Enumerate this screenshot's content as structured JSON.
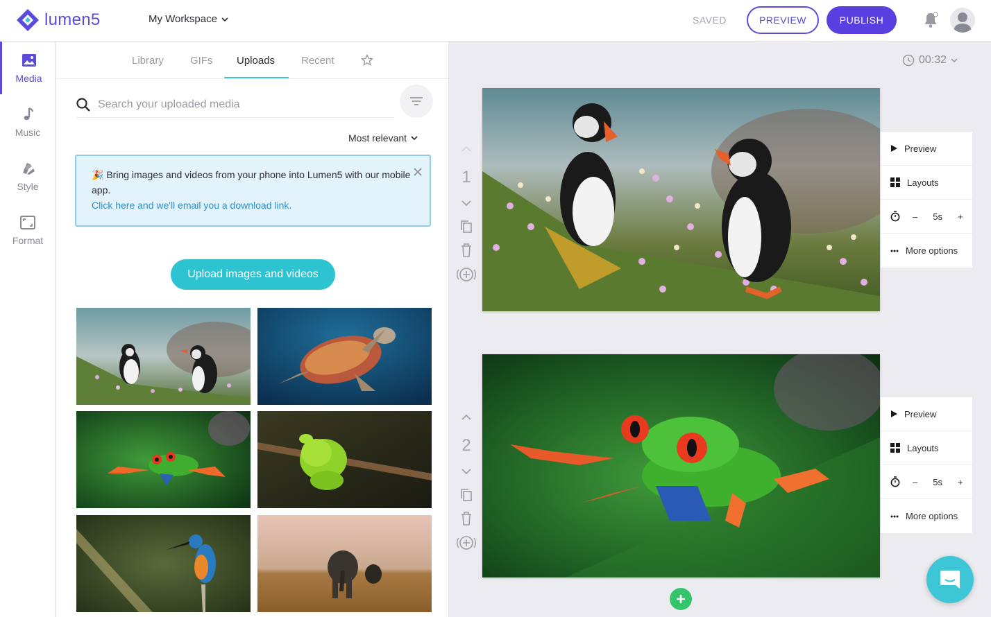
{
  "app": {
    "name": "lumen5",
    "brand_color": "#5a4bdb",
    "accent_color": "#2ec3d1"
  },
  "header": {
    "workspace_label": "My Workspace",
    "status_text": "SAVED",
    "preview_label": "PREVIEW",
    "publish_label": "PUBLISH"
  },
  "sidebar": {
    "items": [
      {
        "label": "Media",
        "icon": "image-icon",
        "active": true
      },
      {
        "label": "Music",
        "icon": "music-note-icon",
        "active": false
      },
      {
        "label": "Style",
        "icon": "palette-icon",
        "active": false
      },
      {
        "label": "Format",
        "icon": "aspect-ratio-icon",
        "active": false
      }
    ]
  },
  "media_panel": {
    "tabs": [
      "Library",
      "GIFs",
      "Uploads",
      "Recent"
    ],
    "active_tab": "Uploads",
    "search": {
      "placeholder": "Search your uploaded media",
      "value": ""
    },
    "sort_label": "Most relevant",
    "banner": {
      "emoji": "🎉",
      "text": "Bring images and videos from your phone into Lumen5 with our mobile app.",
      "link_text": "Click here and we'll email you a download link."
    },
    "upload_button_label": "Upload images and videos",
    "thumbnails": [
      "puffins",
      "sea turtle",
      "tree frog",
      "green snake",
      "kingfisher",
      "elephants"
    ]
  },
  "editor": {
    "duration": "00:32",
    "scenes": [
      {
        "number": "1",
        "image": "puffins",
        "duration": "5s"
      },
      {
        "number": "2",
        "image": "tree frog",
        "duration": "5s"
      }
    ],
    "scene_menu": {
      "preview_label": "Preview",
      "layouts_label": "Layouts",
      "minus_label": "–",
      "plus_label": "+",
      "more_label": "More options"
    }
  }
}
